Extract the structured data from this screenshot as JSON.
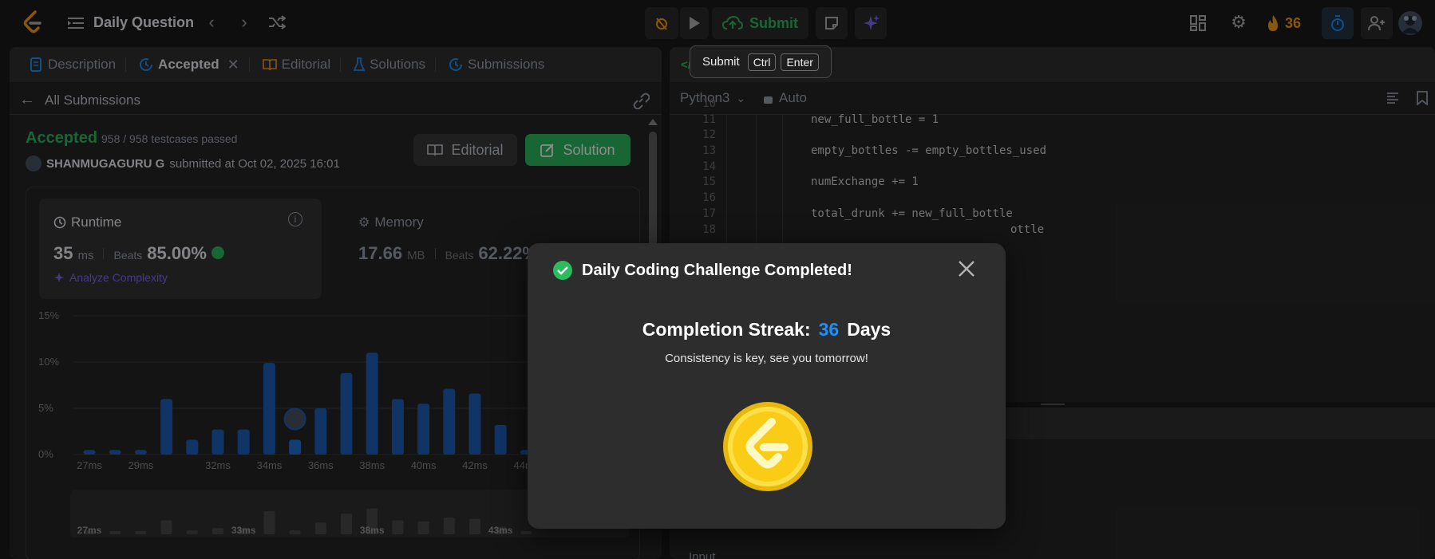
{
  "topbar": {
    "daily_question": "Daily Question",
    "submit_label": "Submit",
    "streak_count": "36"
  },
  "tooltip": {
    "label": "Submit",
    "key1": "Ctrl",
    "key2": "Enter"
  },
  "left_tabs": [
    {
      "label": "Description"
    },
    {
      "label": "Accepted"
    },
    {
      "label": "Editorial"
    },
    {
      "label": "Solutions"
    },
    {
      "label": "Submissions"
    }
  ],
  "submission": {
    "back_label": "All Submissions",
    "status": "Accepted",
    "testcases": "958 / 958 testcases passed",
    "user": "SHANMUGAGURU G",
    "submitted_at": "submitted at Oct 02, 2025 16:01",
    "editorial_btn": "Editorial",
    "solution_btn": "Solution"
  },
  "runtime": {
    "title": "Runtime",
    "value": "35",
    "unit": "ms",
    "beats_label": "Beats",
    "beats_value": "85.00%",
    "analyze": "Analyze Complexity"
  },
  "memory": {
    "title": "Memory",
    "value": "17.66",
    "unit": "MB",
    "beats_label": "Beats",
    "beats_value": "62.22%"
  },
  "chart_data": {
    "type": "bar",
    "categories": [
      "27ms",
      "28ms",
      "29ms",
      "30ms",
      "31ms",
      "32ms",
      "33ms",
      "34ms",
      "35ms",
      "36ms",
      "37ms",
      "38ms",
      "39ms",
      "40ms",
      "41ms",
      "42ms",
      "43ms",
      "44ms"
    ],
    "values": [
      0.5,
      0.5,
      0.5,
      6.0,
      1.6,
      2.7,
      2.7,
      9.9,
      1.6,
      5.0,
      8.8,
      11.0,
      6.0,
      5.5,
      7.1,
      6.6,
      3.2,
      0.5
    ],
    "ylim": [
      0,
      15
    ],
    "yticks": [
      "0%",
      "5%",
      "10%",
      "15%"
    ],
    "xticks": [
      "27ms",
      "29ms",
      "32ms",
      "34ms",
      "36ms",
      "38ms",
      "40ms",
      "42ms",
      "44ms"
    ],
    "highlight": "35ms",
    "mini_ticks": [
      "27ms",
      "33ms",
      "38ms",
      "43ms"
    ]
  },
  "editor": {
    "language": "Python3",
    "mode": "Auto",
    "line_numbers": [
      "10",
      "11",
      "12",
      "13",
      "14",
      "15",
      "16",
      "17",
      "18"
    ],
    "lines": [
      "",
      "new_full_bottle = 1",
      "",
      "empty_bottles -= empty_bottles_used",
      "",
      "numExchange += 1",
      "",
      "total_drunk += new_full_bottle",
      "ottle"
    ],
    "input_label": "Input"
  },
  "modal": {
    "title": "Daily Coding Challenge Completed!",
    "streak_label": "Completion Streak:",
    "streak_value": "36",
    "streak_unit": "Days",
    "message": "Consistency is key, see you tomorrow!"
  },
  "colors": {
    "accent_green": "#2cbb5d",
    "bar_blue": "#1e5fb8",
    "streak_blue": "#1a90ff",
    "orange": "#ffa116"
  }
}
